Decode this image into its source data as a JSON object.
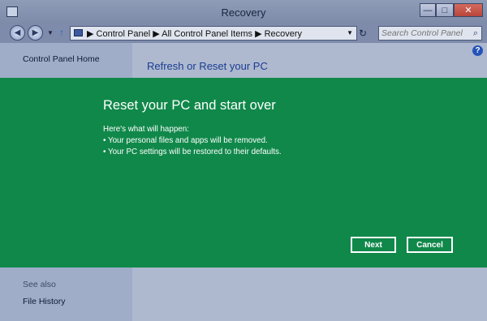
{
  "window": {
    "title": "Recovery",
    "minimize": "—",
    "maximize": "□",
    "close": "✕"
  },
  "nav": {
    "back_icon": "back-arrow-icon",
    "forward_icon": "forward-arrow-icon",
    "up_icon": "up-arrow-icon",
    "address": "▶  Control Panel  ▶  All Control Panel Items  ▶  Recovery",
    "search_placeholder": "Search Control Panel"
  },
  "sidebar": {
    "home": "Control Panel Home",
    "see_also": "See also",
    "file_history": "File History"
  },
  "main": {
    "page_title": "Refresh or Reset your PC",
    "help": "?"
  },
  "dialog": {
    "heading": "Reset your PC and start over",
    "intro": "Here's what will happen:",
    "bullets": [
      "• Your personal files and apps will be removed.",
      "• Your PC settings will be restored to their defaults."
    ],
    "next_label": "Next",
    "cancel_label": "Cancel",
    "color": "#10884a"
  }
}
